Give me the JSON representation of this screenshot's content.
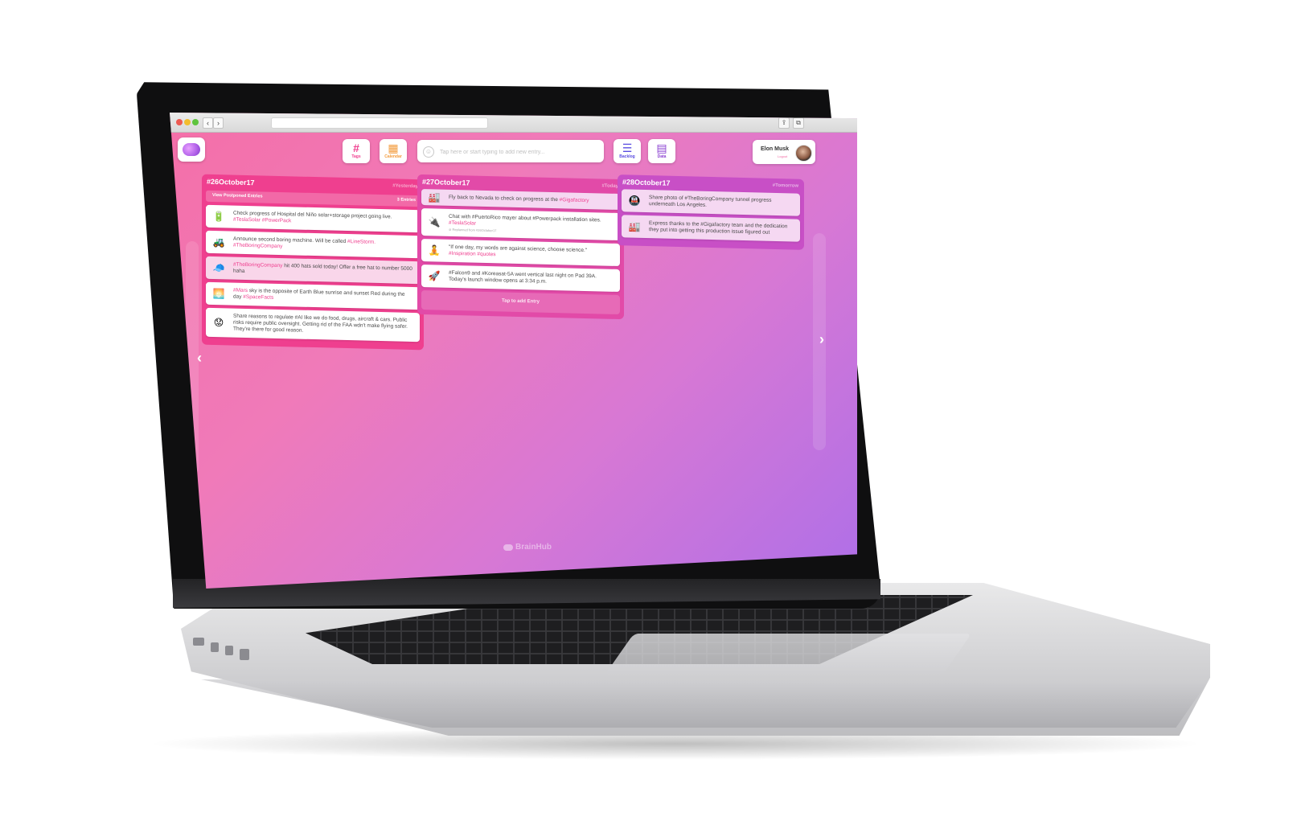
{
  "browser": {
    "back_label": "‹",
    "forward_label": "›",
    "share_icon": "share-icon",
    "tabs_icon": "tabs-icon"
  },
  "header": {
    "logo_icon": "brain-icon",
    "tools": [
      {
        "label": "Tags",
        "glyph": "#",
        "color": "#ef3f8f"
      },
      {
        "label": "Calendar",
        "glyph": "▦",
        "color": "#f39a3a"
      },
      {
        "label": "Backlog",
        "glyph": "☰",
        "color": "#5a4de0"
      },
      {
        "label": "Data",
        "glyph": "▤",
        "color": "#8a3fd0"
      }
    ],
    "search": {
      "placeholder": "Tap here or start typing to add new entry..."
    },
    "user": {
      "name": "Elon Musk",
      "sub": "Logout"
    }
  },
  "columns": [
    {
      "date": "#26October17",
      "relative": "#Yesterday",
      "postponed": {
        "label": "View Postponed Entries",
        "count": "3 Entries"
      },
      "entries": [
        {
          "icon": "battery-icon",
          "emoji": "🔋",
          "text": "Check progress of Hospital del Niño solar+storage project going live.",
          "tags": "#TeslaSolar #PowerPack"
        },
        {
          "icon": "tractor-icon",
          "emoji": "🚜",
          "text": "Announce second boring machine. Will be called",
          "tags": "#LineStorm. #TheBoringCompany"
        },
        {
          "icon": "hat-icon",
          "emoji": "🧢",
          "tags_prefix": "#TheBoringCompany",
          "text": "hit 400 hats sold today! Offer a free hat to number 5000 haha",
          "tags": ""
        },
        {
          "icon": "sunset-icon",
          "emoji": "🌅",
          "tags_prefix": "#Mars",
          "text": "sky is the opposite of Earth Blue sunrise and sunset Red during the day",
          "tags": "#SpaceFacts"
        },
        {
          "icon": "worried-face-icon",
          "emoji": "😟",
          "text": "Share reasons to regulate #AI like we do food, drugs, aircraft & cars. Public risks require public oversight. Getting rid of the FAA wdn't make flying safer. They're there for good reason.",
          "tags": ""
        }
      ]
    },
    {
      "date": "#27October17",
      "relative": "#Today",
      "entries": [
        {
          "icon": "factory-icon",
          "emoji": "🏭",
          "text": "Fly back to Nevada to check on progress at the",
          "tags": "#Gigafactory"
        },
        {
          "icon": "plug-icon",
          "emoji": "🔌",
          "text": "Chat with #PuertoRico mayer about #Powerpack installation sites.",
          "tags": "#TeslaSolar",
          "sub": "⊘ Replanned from #26October17"
        },
        {
          "icon": "meditate-icon",
          "emoji": "🧘",
          "text": "\"If one day, my words are against science, choose science.\"",
          "tags": "#Inspiration #quotes"
        },
        {
          "icon": "rocket-icon",
          "emoji": "🚀",
          "text": "#Falcon9 and #Koreasat-5A went vertical last night on Pad 39A. Today's launch window opens at 3:34 p.m.",
          "tags": ""
        }
      ],
      "add_label": "Tap to add Entry"
    },
    {
      "date": "#28October17",
      "relative": "#Tomorrow",
      "entries": [
        {
          "icon": "tunnel-icon",
          "emoji": "🚇",
          "text": "Share photo of #TheBoringCompany tunnel progress underneath Los Angeles.",
          "tags": ""
        },
        {
          "icon": "factory-icon",
          "emoji": "🏭",
          "text": "Express thanks to the #Gigafactory team and the dedication they put into getting this production issue figured out",
          "tags": ""
        }
      ]
    }
  ],
  "footer": {
    "brand": "BrainHub"
  },
  "colors": {
    "accent": "#ef3f8f",
    "bg_start": "#f46fa8",
    "bg_end": "#ae6fe8"
  }
}
